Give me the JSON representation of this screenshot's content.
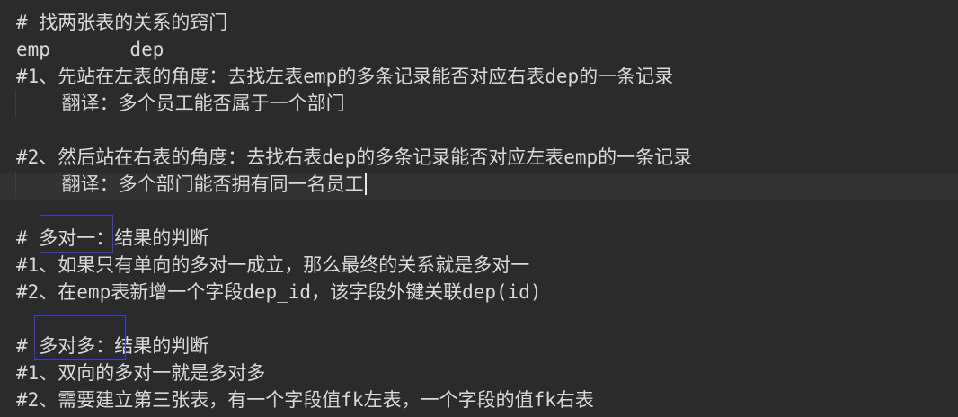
{
  "editor": {
    "lines": [
      "# 找两张表的关系的窍门",
      "emp       dep",
      "#1、先站在左表的角度：去找左表emp的多条记录能否对应右表dep的一条记录",
      "    翻译：多个员工能否属于一个部门",
      "",
      "#2、然后站在右表的角度：去找右表dep的多条记录能否对应左表emp的一条记录",
      "    翻译：多个部门能否拥有同一名员工",
      "",
      "# 多对一：结果的判断",
      "#1、如果只有单向的多对一成立，那么最终的关系就是多对一",
      "#2、在emp表新增一个字段dep_id，该字段外键关联dep(id)",
      "",
      "# 多对多：结果的判断",
      "#1、双向的多对一就是多对多",
      "#2、需要建立第三张表，有一个字段值fk左表，一个字段的值fk右表"
    ],
    "colors": {
      "background": "#2b2b2b",
      "current_line": "#323232",
      "text": "#d9d9d9",
      "highlight_box": "#3a3ae0"
    }
  }
}
